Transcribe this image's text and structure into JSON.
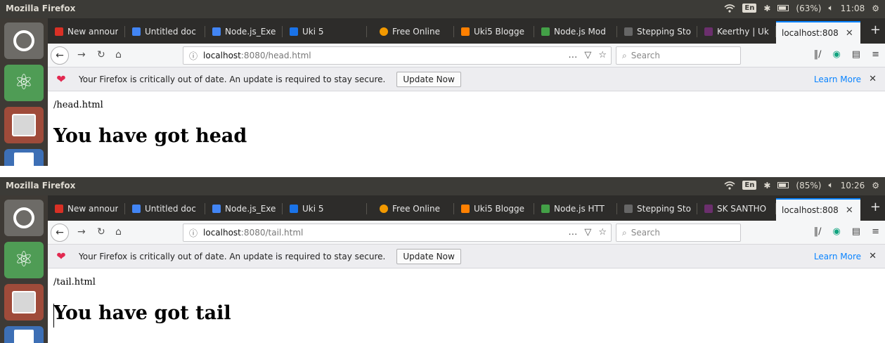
{
  "colors": {
    "panel_bg": "#3c3b37",
    "tabstrip_bg": "#2d2c2a",
    "active_tab_bg": "#f5f6f7",
    "accent_blue": "#0a84ff",
    "heart_red": "#e22850"
  },
  "screens": [
    {
      "panel": {
        "title": "Mozilla Firefox",
        "battery": "(63%)",
        "time": "11:08",
        "lang": "En"
      },
      "tabs": [
        {
          "label": "New annour",
          "icon": "gmail-icon",
          "color": "#d93025"
        },
        {
          "label": "Untitled doc",
          "icon": "docs-icon",
          "color": "#4285f4"
        },
        {
          "label": "Node.js_Exe",
          "icon": "docs-icon",
          "color": "#4285f4"
        },
        {
          "label": "Uki 5",
          "icon": "classroom-icon",
          "color": "#1a73e8"
        },
        {
          "label": "Free Online",
          "icon": "orange-icon",
          "color": "#f29900"
        },
        {
          "label": "Uki5 Blogge",
          "icon": "blogger-icon",
          "color": "#ff8000"
        },
        {
          "label": "Node.js Mod",
          "icon": "node-icon",
          "color": "#43a047"
        },
        {
          "label": "Stepping Sto",
          "icon": "dim-icon",
          "color": "#666666"
        },
        {
          "label": "Keerthy | Uk",
          "icon": "slack-icon",
          "color": "#6b2f6d"
        }
      ],
      "active_tab": {
        "label": "localhost:808"
      },
      "url": {
        "host": "localhost",
        "rest": ":8080/head.html"
      },
      "search_placeholder": "Search",
      "notice": {
        "message": "Your Firefox is critically out of date. An update is required to stay secure.",
        "button": "Update Now",
        "learn_more": "Learn More"
      },
      "page": {
        "path": "/head.html",
        "heading": "You have got head"
      }
    },
    {
      "panel": {
        "title": "Mozilla Firefox",
        "battery": "(85%)",
        "time": "10:26",
        "lang": "En"
      },
      "tabs": [
        {
          "label": "New annour",
          "icon": "gmail-icon",
          "color": "#d93025"
        },
        {
          "label": "Untitled doc",
          "icon": "docs-icon",
          "color": "#4285f4"
        },
        {
          "label": "Node.js_Exe",
          "icon": "docs-icon",
          "color": "#4285f4"
        },
        {
          "label": "Uki 5",
          "icon": "classroom-icon",
          "color": "#1a73e8"
        },
        {
          "label": "Free Online",
          "icon": "orange-icon",
          "color": "#f29900"
        },
        {
          "label": "Uki5 Blogge",
          "icon": "blogger-icon",
          "color": "#ff8000"
        },
        {
          "label": "Node.js HTT",
          "icon": "node-icon",
          "color": "#43a047"
        },
        {
          "label": "Stepping Sto",
          "icon": "dim-icon",
          "color": "#666666"
        },
        {
          "label": "SK SANTHO",
          "icon": "slack-icon",
          "color": "#6b2f6d"
        }
      ],
      "active_tab": {
        "label": "localhost:808"
      },
      "url": {
        "host": "localhost",
        "rest": ":8080/tail.html"
      },
      "search_placeholder": "Search",
      "notice": {
        "message": "Your Firefox is critically out of date. An update is required to stay secure.",
        "button": "Update Now",
        "learn_more": "Learn More"
      },
      "page": {
        "path": "/tail.html",
        "heading": "You have got tail"
      }
    }
  ]
}
